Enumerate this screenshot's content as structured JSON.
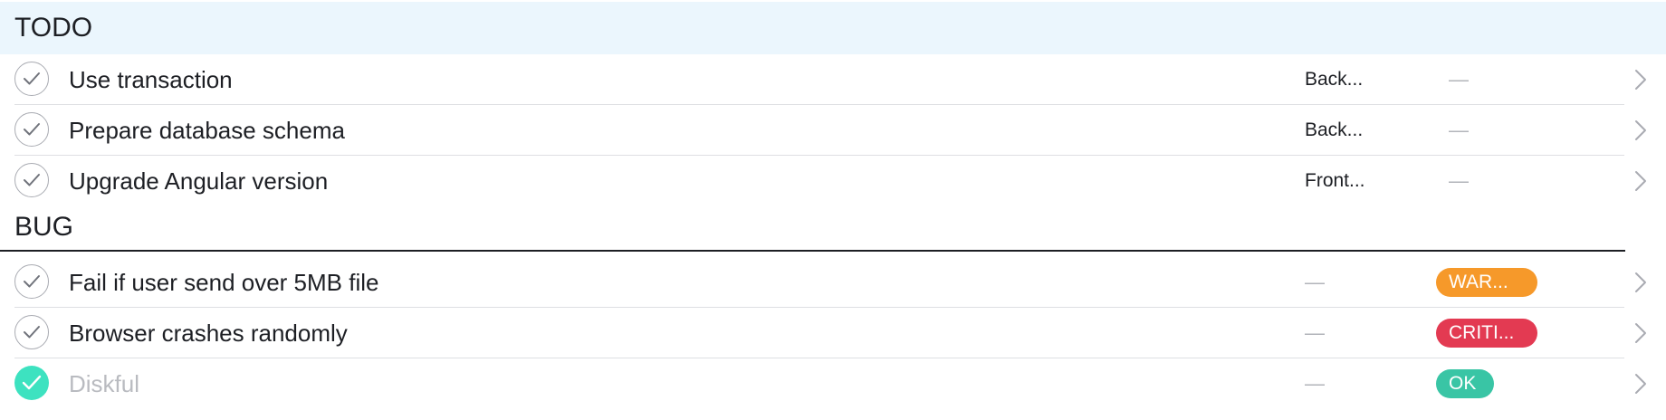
{
  "sections": [
    {
      "title": "TODO",
      "tasks": [
        {
          "title": "Use transaction",
          "project": "Back...",
          "status": "—",
          "completed": false
        },
        {
          "title": "Prepare database schema",
          "project": "Back...",
          "status": "—",
          "completed": false
        },
        {
          "title": "Upgrade Angular version",
          "project": "Front...",
          "status": "—",
          "completed": false
        }
      ]
    },
    {
      "title": "BUG",
      "tasks": [
        {
          "title": "Fail if user send over 5MB file",
          "project": "—",
          "status": "WAR...",
          "status_color": "#f6992a",
          "completed": false
        },
        {
          "title": "Browser crashes randomly",
          "project": "—",
          "status": "CRITI...",
          "status_color": "#e33a52",
          "completed": false
        },
        {
          "title": "Diskful",
          "project": "—",
          "status": "OK",
          "status_color": "#39c5a5",
          "completed": true
        }
      ]
    }
  ],
  "colors": {
    "todo_header_bg": "#ebf6fd",
    "check_done": "#3de2c0",
    "text": "#1d1f24",
    "muted": "#b9bbc0"
  },
  "icons": {
    "check": "check-icon",
    "chevron": "chevron-right-icon"
  }
}
